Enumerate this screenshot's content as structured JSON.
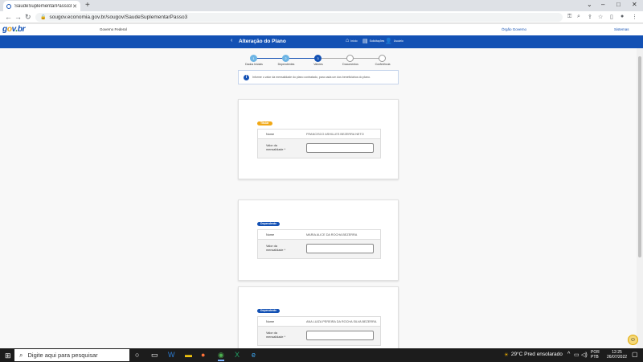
{
  "browser": {
    "tab_title": "SaudeSuplementarPasso3",
    "url": "sougov.economia.gov.br/sougov/SaudeSuplementarPasso3"
  },
  "govbar": {
    "logo": "gov.br",
    "label": "Governo Federal",
    "right_link_1": "Órgão Governo",
    "right_link_2": "Sistemas"
  },
  "app": {
    "title": "Alteração do Plano",
    "nav": [
      {
        "icon": "home-icon",
        "label": "Início"
      },
      {
        "icon": "document-icon",
        "label": "Solicitações"
      },
      {
        "icon": "user-icon",
        "label": "Usuário"
      }
    ]
  },
  "stepper": {
    "steps": [
      {
        "num": "1",
        "label": "Dados Iniciais",
        "state": "done"
      },
      {
        "num": "2",
        "label": "Dependentes",
        "state": "done"
      },
      {
        "num": "3",
        "label": "Valores",
        "state": "active"
      },
      {
        "num": "4",
        "label": "Documentos",
        "state": "todo"
      },
      {
        "num": "5",
        "label": "Conferência",
        "state": "todo"
      }
    ]
  },
  "info": "Informe o valor da mensalidade do plano contratado, para cada um dos beneficiários do plano.",
  "cards": [
    {
      "badge": "Titular",
      "badge_color": "#f1a815",
      "name_label": "Nome",
      "name_value": "FRANCISCO ASHILLES BEZERRA NETO",
      "value_label": "Valor da mensalidade *"
    },
    {
      "badge": "Dependente",
      "badge_color": "#1351b4",
      "name_label": "Nome",
      "name_value": "MARIA ALICE DA ROCHA BEZERRA",
      "value_label": "Valor da mensalidade *"
    },
    {
      "badge": "Dependente",
      "badge_color": "#1351b4",
      "name_label": "Nome",
      "name_value": "ANA LUIZA PEREIRA DA ROCHA SILVA BEZERRA",
      "value_label": "Valor da mensalidade *"
    }
  ],
  "taskbar": {
    "search_placeholder": "Digite aqui para pesquisar",
    "weather": "29°C  Pred ensolarado",
    "lang_1": "POR",
    "lang_2": "PTB",
    "time": "12:25",
    "date": "26/07/2022"
  }
}
